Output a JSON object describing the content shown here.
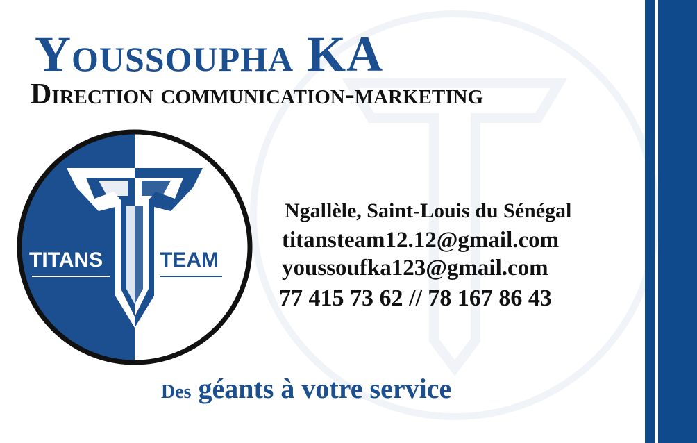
{
  "card": {
    "name": "Youssoupha KA",
    "role": "Direction communication-marketing",
    "logo": {
      "left_text": "TITANS",
      "right_text": "TEAM"
    },
    "address": "Ngallèle, Saint-Louis du Sénégal",
    "email_1": "titansteam12.12@gmail.com",
    "email_2": "youssoufka123@gmail.com",
    "phones": "77 415 73 62 // 78 167 86 43",
    "slogan_initial": "Des",
    "slogan_rest": " géants à votre service"
  },
  "colors": {
    "brand_blue": "#1b4f8f",
    "bar_blue": "#0e4a8c",
    "text_dark": "#111111"
  }
}
